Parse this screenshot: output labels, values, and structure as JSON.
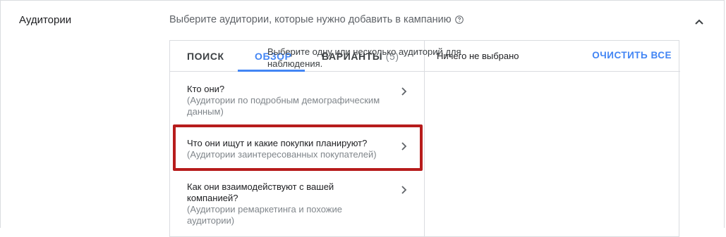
{
  "section": {
    "title": "Аудитории",
    "instruction": "Выберите аудитории, которые нужно добавить в кампанию"
  },
  "tabs": [
    {
      "label": "ПОИСК",
      "active": false
    },
    {
      "label": "ОБЗОР",
      "active": true
    },
    {
      "label": "ВАРИАНТЫ",
      "count": "(5)",
      "active": false
    }
  ],
  "browse_items": [
    {
      "title": "Кто они?",
      "subtitle": "(Аудитории по подробным демографическим данным)"
    },
    {
      "title": "Что они ищут и какие покупки планируют?",
      "subtitle": "(Аудитории заинтересованных покупателей)"
    },
    {
      "title": "Как они взаимодействуют с вашей компанией?",
      "subtitle": "(Аудитории ремаркетинга и похожие аудитории)"
    }
  ],
  "selection": {
    "status": "Ничего не выбрано",
    "clear_label": "ОЧИСТИТЬ ВСЕ",
    "hint": "Выберите одну или несколько аудиторий для наблюдения."
  },
  "colors": {
    "accent": "#4285f4",
    "highlight_border": "#b71c1c",
    "muted_text": "#80868b"
  },
  "icons": {
    "help": "help-circle-icon",
    "collapse": "chevron-up-icon",
    "item_arrow": "chevron-right-icon"
  }
}
